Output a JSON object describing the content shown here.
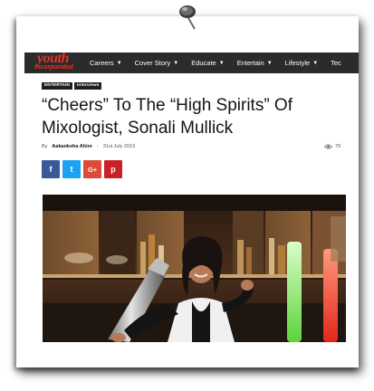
{
  "brand": {
    "logo_line1": "youth",
    "logo_line2": "incorporated",
    "accent": "#e4312b",
    "nav_bg": "#2b2b2b"
  },
  "nav": {
    "items": [
      {
        "label": "Careers",
        "icon": "chevron-down-icon"
      },
      {
        "label": "Cover Story",
        "icon": "chevron-down-icon"
      },
      {
        "label": "Educate",
        "icon": "chevron-down-icon"
      },
      {
        "label": "Entertain",
        "icon": "chevron-down-icon"
      },
      {
        "label": "Lifestyle",
        "icon": "chevron-down-icon"
      },
      {
        "label": "Tec",
        "icon": ""
      }
    ]
  },
  "article": {
    "tags": [
      "ENTERTAIN",
      "Interviews"
    ],
    "title": "“Cheers” To The “High Spirits” Of Mixologist, Sonali Mullick",
    "by": "By",
    "author": "Aakanksha Ahire",
    "separator": "-",
    "date": "31st July 2019",
    "views": "79",
    "views_icon": "eye-icon"
  },
  "share": {
    "facebook": "f",
    "twitter": "t",
    "google_plus": "G+",
    "pinterest": "p",
    "colors": {
      "facebook": "#3b5998",
      "twitter": "#1da1f2",
      "google_plus": "#dc4a38",
      "pinterest": "#ca2127"
    }
  },
  "photo": {
    "subject": "bartender-with-cocktail-shaker"
  }
}
